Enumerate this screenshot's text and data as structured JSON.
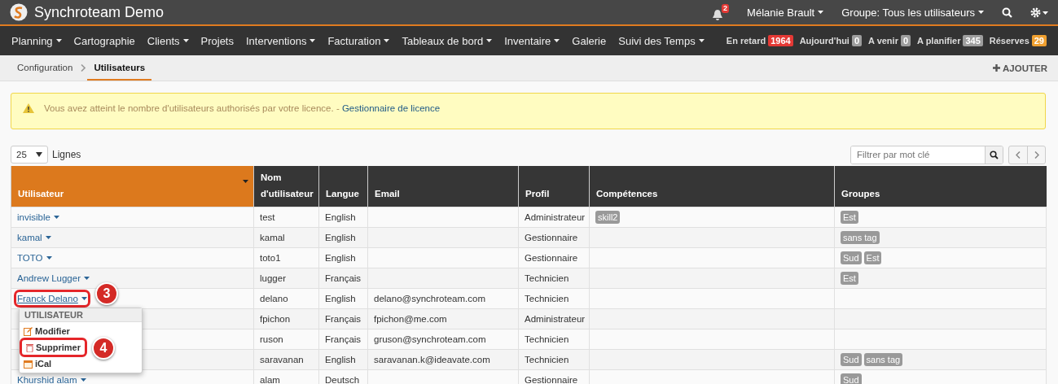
{
  "app": {
    "title": "Synchroteam Demo",
    "notifications": "2",
    "user": "Mélanie Brault",
    "group": "Groupe: Tous les utilisateurs"
  },
  "nav": [
    {
      "label": "Planning",
      "dropdown": true
    },
    {
      "label": "Cartographie",
      "dropdown": false
    },
    {
      "label": "Clients",
      "dropdown": true
    },
    {
      "label": "Projets",
      "dropdown": false
    },
    {
      "label": "Interventions",
      "dropdown": true
    },
    {
      "label": "Facturation",
      "dropdown": true
    },
    {
      "label": "Tableaux de bord",
      "dropdown": true
    },
    {
      "label": "Inventaire",
      "dropdown": true
    },
    {
      "label": "Galerie",
      "dropdown": false
    },
    {
      "label": "Suivi des Temps",
      "dropdown": true
    }
  ],
  "counters": [
    {
      "label": "En retard",
      "count": "1964",
      "color": "#e53935"
    },
    {
      "label": "Aujourd'hui",
      "count": "0",
      "color": "#9e9e9e"
    },
    {
      "label": "A venir",
      "count": "0",
      "color": "#9e9e9e"
    },
    {
      "label": "A planifier",
      "count": "345",
      "color": "#9e9e9e"
    },
    {
      "label": "Réserves",
      "count": "29",
      "color": "#f0a030"
    }
  ],
  "breadcrumb": [
    {
      "label": "Configuration",
      "selected": false
    },
    {
      "label": "Utilisateurs",
      "selected": true
    }
  ],
  "add_button": "AJOUTER",
  "alert": {
    "message": "Vous avez atteint le nombre d'utilisateurs authorisés par votre licence. - ",
    "link": "Gestionnaire de licence"
  },
  "page_size": "25",
  "page_size_label": "Lignes",
  "search": {
    "placeholder": "Filtrer par mot clé"
  },
  "table": {
    "columns": [
      {
        "label": "Utilisateur",
        "sorted": true
      },
      {
        "label": "Nom d'utilisateur",
        "sorted": false
      },
      {
        "label": "Langue",
        "sorted": false
      },
      {
        "label": "Email",
        "sorted": false
      },
      {
        "label": "Profil",
        "sorted": false
      },
      {
        "label": "Compétences",
        "sorted": false
      },
      {
        "label": "Groupes",
        "sorted": false
      }
    ],
    "rows": [
      {
        "user": "invisible",
        "highlighted": false,
        "username": "test",
        "language": "English",
        "email": "",
        "profile": "Administrateur",
        "skills": [
          "skill2"
        ],
        "groups": [
          "Est"
        ]
      },
      {
        "user": "kamal",
        "highlighted": false,
        "username": "kamal",
        "language": "English",
        "email": "",
        "profile": "Gestionnaire",
        "skills": [],
        "groups": [
          "sans tag"
        ]
      },
      {
        "user": "TOTO",
        "highlighted": false,
        "username": "toto1",
        "language": "English",
        "email": "",
        "profile": "Gestionnaire",
        "skills": [],
        "groups": [
          "Sud",
          "Est"
        ]
      },
      {
        "user": "Andrew Lugger",
        "highlighted": false,
        "username": "lugger",
        "language": "Français",
        "email": "",
        "profile": "Technicien",
        "skills": [],
        "groups": [
          "Est"
        ]
      },
      {
        "user": "Franck Delano",
        "highlighted": true,
        "callout": "3",
        "username": "delano",
        "language": "English",
        "email": "delano@synchroteam.com",
        "profile": "Technicien",
        "skills": [],
        "groups": [],
        "menu": {
          "header": "UTILISATEUR",
          "items": [
            {
              "label": "Modifier",
              "highlighted": false
            },
            {
              "label": "Supprimer",
              "highlighted": true,
              "callout": "4"
            },
            {
              "label": "iCal",
              "highlighted": false
            }
          ]
        }
      },
      {
        "username": "fpichon",
        "language": "Français",
        "email": "fpichon@me.com",
        "profile": "Administrateur",
        "skills": [],
        "groups": []
      },
      {
        "username": "ruson",
        "language": "Français",
        "email": "gruson@synchroteam.com",
        "profile": "Technicien",
        "skills": [],
        "groups": []
      },
      {
        "username": "saravanan",
        "language": "English",
        "email": "saravanan.k@ideavate.com",
        "profile": "Technicien",
        "skills": [],
        "groups": [
          "Sud",
          "sans tag"
        ]
      },
      {
        "user": "Khurshid alam",
        "highlighted": false,
        "username": "alam",
        "language": "Deutsch",
        "email": "",
        "profile": "Gestionnaire",
        "skills": [],
        "groups": [
          "Sud"
        ]
      }
    ]
  }
}
